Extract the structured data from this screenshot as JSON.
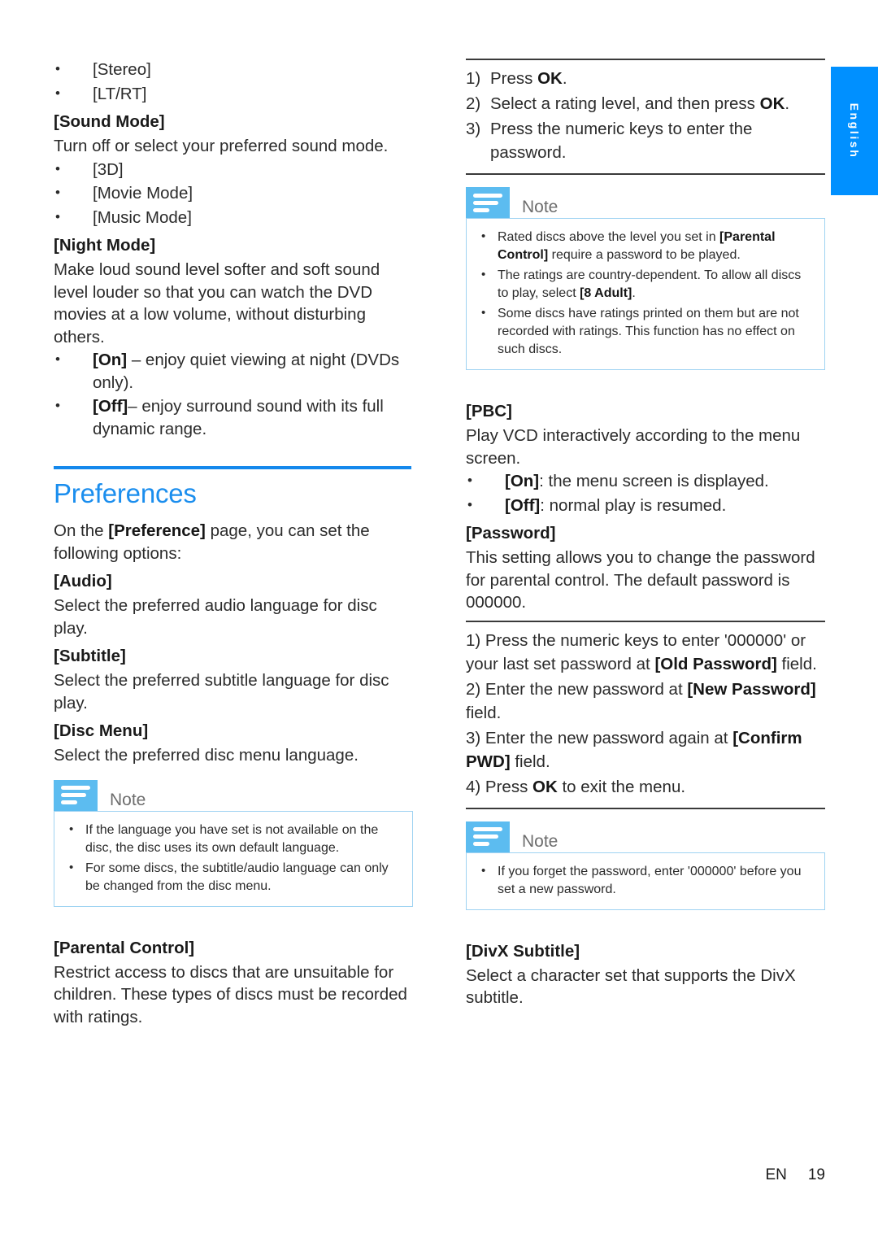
{
  "language_tab": {
    "label": "English"
  },
  "footer": {
    "locale": "EN",
    "page_number": "19"
  },
  "left_column": {
    "sound_options": [
      {
        "label": "[Stereo]"
      },
      {
        "label": "[LT/RT]"
      }
    ],
    "sound_mode": {
      "heading": "[Sound Mode]",
      "description": "Turn off or select your preferred sound mode.",
      "options": [
        {
          "label": "[3D]"
        },
        {
          "label": "[Movie Mode]"
        },
        {
          "label": "[Music Mode]"
        }
      ]
    },
    "night_mode": {
      "heading": "[Night Mode]",
      "description": "Make loud sound level softer and soft sound level louder so that you can watch the DVD movies at a low volume, without disturbing others.",
      "options": [
        {
          "bold": "[On]",
          "rest": " – enjoy quiet viewing at night (DVDs only)."
        },
        {
          "bold": "[Off]",
          "rest": "– enjoy surround sound with its full dynamic range."
        }
      ]
    },
    "preferences_section": {
      "title": "Preferences",
      "intro_a": "On the ",
      "intro_bold": "[Preference]",
      "intro_b": " page, you can set the following options:",
      "entries": [
        {
          "heading": "[Audio]",
          "description": "Select the preferred audio language for disc play."
        },
        {
          "heading": "[Subtitle]",
          "description": "Select the preferred subtitle language for disc play."
        },
        {
          "heading": "[Disc Menu]",
          "description": "Select the preferred disc menu language."
        }
      ]
    },
    "note": {
      "title": "Note",
      "items": [
        "If the language you have set is not available on the disc, the disc uses its own default language.",
        "For some discs, the subtitle/audio language can only be changed from the disc menu."
      ]
    },
    "parental_control": {
      "heading": "[Parental Control]",
      "description": "Restrict access to discs that are unsuitable for children. These types of discs must be recorded with ratings."
    }
  },
  "right_column": {
    "rating_steps": [
      {
        "num": "1)",
        "text_a": "Press ",
        "bold": "OK",
        "text_b": "."
      },
      {
        "num": "2)",
        "text_a": "Select a rating level, and then press ",
        "bold": "OK",
        "text_b": "."
      },
      {
        "num": "3)",
        "text_a": "Press the numeric keys to enter the password.",
        "bold": "",
        "text_b": ""
      }
    ],
    "note_rating": {
      "title": "Note",
      "items": [
        {
          "a": "Rated discs above the level you set in ",
          "bold": "[Parental Control]",
          "b": " require a password to be played."
        },
        {
          "a": "The ratings are country-dependent. To allow all discs to play, select ",
          "bold": "[8 Adult]",
          "b": "."
        },
        {
          "a": "Some discs have ratings printed on them but are not recorded with ratings. This function has no effect on such discs.",
          "bold": "",
          "b": ""
        }
      ]
    },
    "pbc": {
      "heading": "[PBC]",
      "description": "Play VCD interactively according to the menu screen.",
      "options": [
        {
          "bold": "[On]",
          "rest": ": the menu screen is displayed."
        },
        {
          "bold": "[Off]",
          "rest": ": normal play is resumed."
        }
      ]
    },
    "password": {
      "heading": "[Password]",
      "description": "This setting allows you to change the password for parental control. The default password is 000000.",
      "steps": [
        {
          "num": "1)",
          "a": " Press the numeric keys to enter '000000' or your last set password at ",
          "bold": "[Old Password]",
          "b": " field."
        },
        {
          "num": "2)",
          "a": " Enter the new password at ",
          "bold": "[New Password]",
          "b": " field."
        },
        {
          "num": "3)",
          "a": " Enter the new password again at ",
          "bold": "[Confirm PWD]",
          "b": " field."
        },
        {
          "num": "4)",
          "a": " Press ",
          "bold": "OK",
          "b": " to exit the menu."
        }
      ]
    },
    "note_password": {
      "title": "Note",
      "items": [
        "If you forget the password, enter '000000' before you set a new password."
      ]
    },
    "divx_subtitle": {
      "heading": "[DivX Subtitle]",
      "description": "Select a character set that supports the DivX subtitle."
    }
  }
}
